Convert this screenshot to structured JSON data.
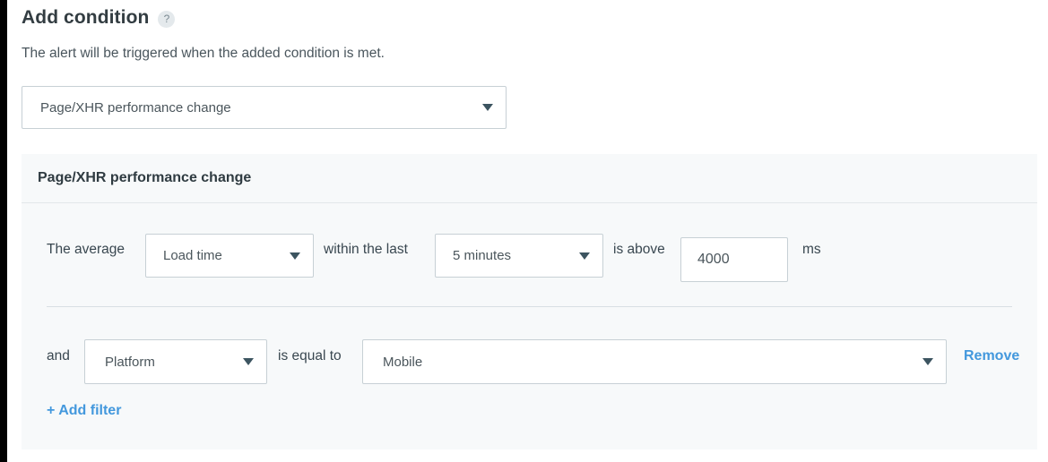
{
  "page": {
    "title": "Add condition",
    "help_icon": "question-mark-icon",
    "description": "The alert will be triggered when the added condition is met."
  },
  "condition_type": {
    "selected": "Page/XHR performance change",
    "caret": "chevron-down-icon"
  },
  "panel": {
    "header": "Page/XHR performance change",
    "condition_row": {
      "prefix_label": "The average",
      "metric": "Load time",
      "middle_label": "within the last",
      "timeframe": "5 minutes",
      "comparator_label": "is above",
      "threshold_value": "4000",
      "threshold_placeholder": "",
      "unit_label": "ms"
    },
    "filter_row": {
      "conjunction_label": "and",
      "field": "Platform",
      "operator_label": "is equal to",
      "value": "Mobile",
      "remove_label": "Remove"
    },
    "add_filter_label": "+ Add filter"
  },
  "colors": {
    "link": "#4398dd",
    "panel_background": "#f7f9fa",
    "border": "#c7d0d5",
    "text": "#394750",
    "rail": "#000000"
  }
}
